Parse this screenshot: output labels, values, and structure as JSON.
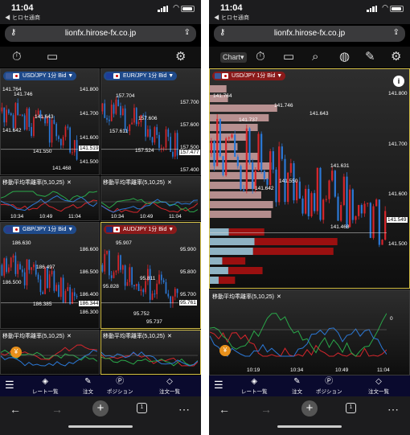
{
  "status": {
    "time": "11:04",
    "back": "◀ ヒロセ通商"
  },
  "browser": {
    "url": "lionfx.hirose-fx.co.jp",
    "tab_count": "1"
  },
  "toolbar": {
    "chart_label": "Chart▾"
  },
  "sub_label": "移動平均乖離率(5,10,25)",
  "close_x": "✕",
  "left": {
    "usdjpy": {
      "pair": "USD/JPY 1分 Bid ▼",
      "labels": [
        "141.764",
        "141.746",
        "141.643",
        "141.642",
        "141.550",
        "141.468"
      ],
      "axis": [
        "141.800",
        "141.700",
        "141.600",
        "141.500"
      ],
      "cur": "141.519"
    },
    "eurjpy": {
      "pair": "EUR/JPY 1分 Bid ▼",
      "labels": [
        "157.704",
        "157.606",
        "157.611",
        "157.524"
      ],
      "axis": [
        "157.700",
        "157.600",
        "157.500",
        "157.400"
      ],
      "cur": "157.477"
    },
    "gbpjpy": {
      "pair": "GBP/JPY 1分 Bid ▼",
      "labels": [
        "186.630",
        "186.497",
        "186.500",
        "186.385"
      ],
      "axis": [
        "186.600",
        "186.500",
        "186.400",
        "186.300"
      ],
      "cur": "186.344"
    },
    "audjpy": {
      "pair": "AUD/JPY 1分 Bid ▼",
      "labels": [
        "95.907",
        "95.811",
        "95.828",
        "95.752",
        "95.737"
      ],
      "axis": [
        "95.900",
        "95.800",
        "95.700"
      ],
      "cur": "95.761"
    },
    "times": [
      "10:34",
      "10:49",
      "11:04"
    ]
  },
  "right": {
    "pair": "USD/JPY 1分 Bid ▼",
    "labels": [
      "141.764",
      "141.737",
      "141.746",
      "141.643",
      "141.631",
      "141.642",
      "141.550",
      "141.468"
    ],
    "axis": [
      "141.800",
      "141.700",
      "141.600",
      "141.500"
    ],
    "cur": "141.549",
    "zero": "0",
    "times": [
      "10:19",
      "10:34",
      "10:49",
      "11:04"
    ]
  },
  "bottom_nav": {
    "items": [
      {
        "label": "レート一覧",
        "icon": "rate-list-icon"
      },
      {
        "label": "注文",
        "icon": "order-icon"
      },
      {
        "label": "ポジション",
        "icon": "position-icon"
      },
      {
        "label": "注文一覧",
        "icon": "order-list-icon"
      }
    ]
  },
  "colors": {
    "up": "#d6262c",
    "down": "#2b78d6",
    "accent": "#d6c24a",
    "nav": "#0a0a2e",
    "info": "i"
  }
}
